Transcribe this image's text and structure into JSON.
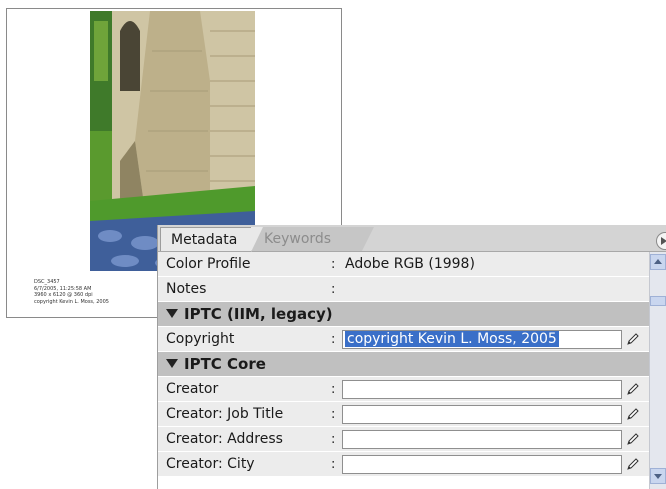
{
  "thumbnail": {
    "caption": [
      "DSC_3457",
      "6/7/2005, 11:25:58 AM",
      "3960 x 6120 @ 360 dpi",
      "copyright Kevin L. Moss, 2005"
    ]
  },
  "panel": {
    "tabs": [
      {
        "label": "Metadata",
        "active": true
      },
      {
        "label": "Keywords",
        "active": false
      }
    ],
    "rows": [
      {
        "label": "Color Profile",
        "value": "Adobe RGB (1998)"
      },
      {
        "label": "Notes",
        "value": ""
      }
    ],
    "sections": [
      {
        "title": "IPTC (IIM, legacy)",
        "fields": [
          {
            "label": "Copyright",
            "value": "copyright Kevin L. Moss, 2005",
            "selected": true
          }
        ]
      },
      {
        "title": "IPTC Core",
        "fields": [
          {
            "label": "Creator",
            "value": ""
          },
          {
            "label": "Creator: Job Title",
            "value": ""
          },
          {
            "label": "Creator: Address",
            "value": ""
          },
          {
            "label": "Creator: City",
            "value": ""
          }
        ]
      }
    ],
    "colon": ":",
    "icons": {
      "edit": "pencil-icon",
      "section": "triangle-down-icon",
      "menu": "panel-menu-icon"
    }
  },
  "colors": {
    "selection": "#3a6fc8",
    "section_header": "#c0c0c0",
    "field_row": "#ececec"
  }
}
